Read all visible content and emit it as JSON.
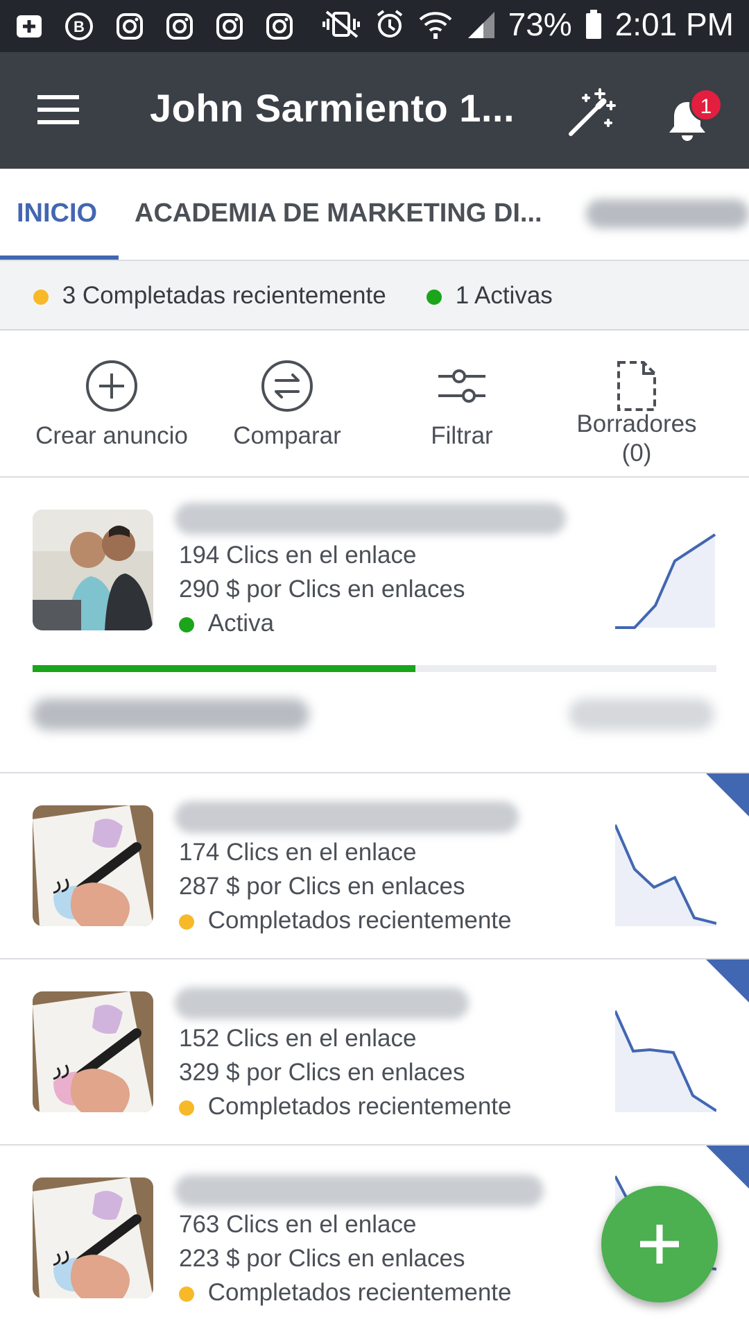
{
  "status_bar": {
    "battery": "73%",
    "time": "2:01 PM"
  },
  "header": {
    "title": "John Sarmiento 1...",
    "notification_count": "1"
  },
  "tabs": [
    {
      "label": "INICIO"
    },
    {
      "label": "ACADEMIA DE MARKETING DI..."
    }
  ],
  "summary": {
    "completed": "3 Completadas recientemente",
    "active": "1 Activas"
  },
  "actions": {
    "create": "Crear anuncio",
    "compare": "Comparar",
    "filter": "Filtrar",
    "drafts": "Borradores",
    "drafts_count": "(0)"
  },
  "ads": [
    {
      "clicks": "194 Clics en el enlace",
      "cost": "290 $ por Clics en enlaces",
      "status": "Activa",
      "progress": 0.56
    },
    {
      "clicks": "174 Clics en el enlace",
      "cost": "287 $ por Clics en enlaces",
      "status": "Completados recientemente"
    },
    {
      "clicks": "152 Clics en el enlace",
      "cost": "329 $ por Clics en enlaces",
      "status": "Completados recientemente"
    },
    {
      "clicks": "763 Clics en el enlace",
      "cost": "223 $ por Clics en enlaces",
      "status": "Completados recientemente"
    }
  ],
  "colors": {
    "active_green": "#1aa51a",
    "completed_yellow": "#f7b928",
    "accent_blue": "#4267b2",
    "fab_green": "#4caf50"
  }
}
